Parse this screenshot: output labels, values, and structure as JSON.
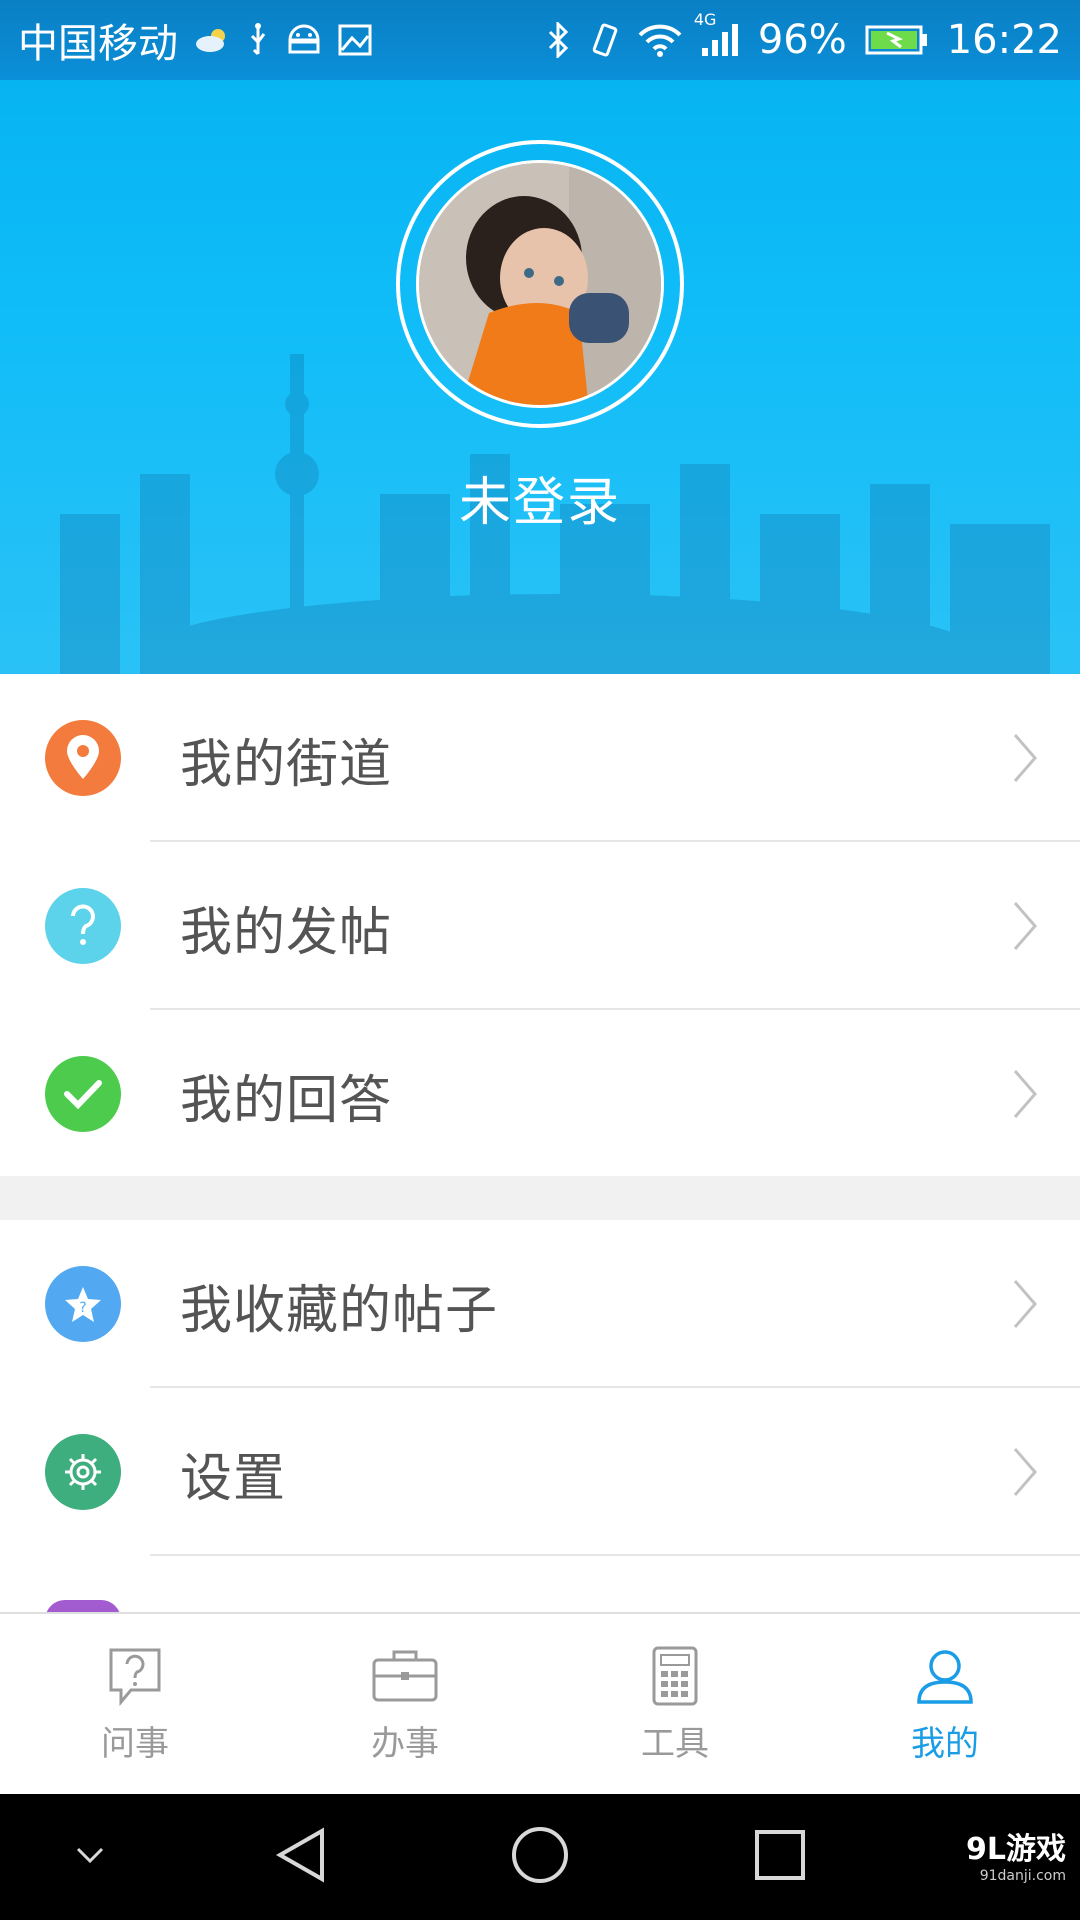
{
  "status_bar": {
    "carrier": "中国移动",
    "network_type": "4G",
    "battery": "96%",
    "time": "16:22"
  },
  "profile": {
    "username": "未登录"
  },
  "menu": {
    "group1": [
      {
        "label": "我的街道",
        "icon": "location-pin-icon",
        "color": "#f47b3e"
      },
      {
        "label": "我的发帖",
        "icon": "question-icon",
        "color": "#5cd3ea"
      },
      {
        "label": "我的回答",
        "icon": "check-icon",
        "color": "#4ccb4d"
      }
    ],
    "group2": [
      {
        "label": "我收藏的帖子",
        "icon": "star-icon",
        "color": "#52a9f1"
      },
      {
        "label": "设置",
        "icon": "gear-icon",
        "color": "#3fae7e"
      }
    ]
  },
  "tabs": [
    {
      "label": "问事",
      "icon": "question-bubble-icon",
      "active": false
    },
    {
      "label": "办事",
      "icon": "briefcase-icon",
      "active": false
    },
    {
      "label": "工具",
      "icon": "calculator-icon",
      "active": false
    },
    {
      "label": "我的",
      "icon": "person-icon",
      "active": true
    }
  ],
  "watermark": {
    "brand": "9L游戏",
    "url": "91danji.com"
  },
  "colors": {
    "header_blue": "#10bdf8",
    "accent_blue": "#1a9de6",
    "label_gray": "#545454"
  }
}
